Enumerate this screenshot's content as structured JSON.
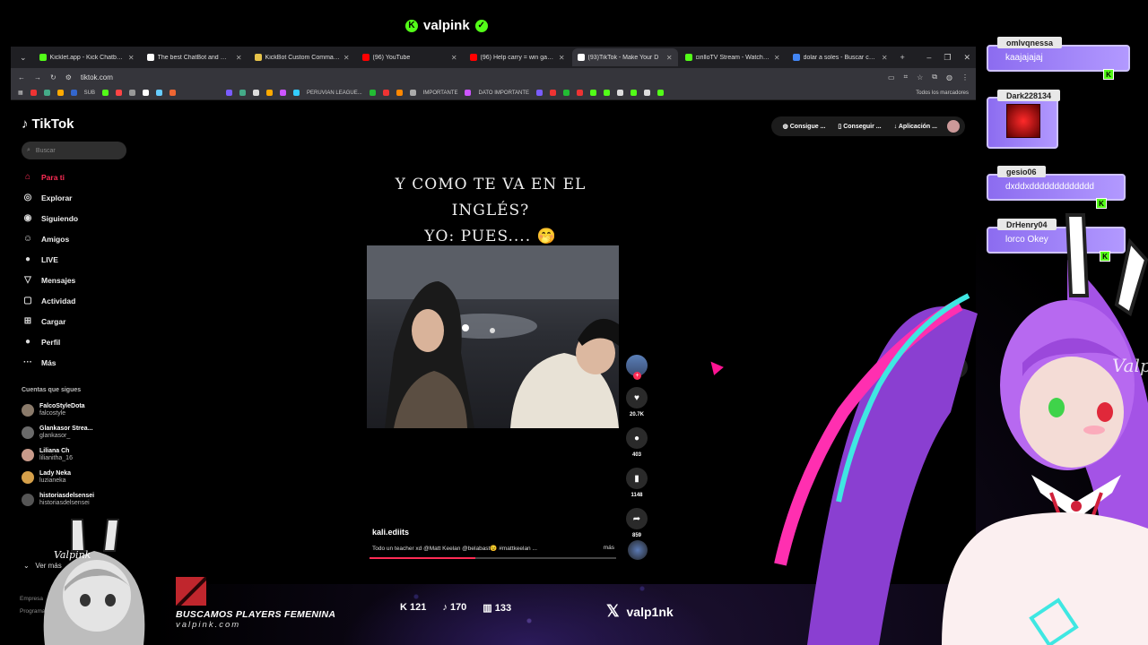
{
  "stream": {
    "top_username": "valpink",
    "promo_text": "BUSCAMOS PLAYERS FEMENINA",
    "promo_url": "valpink.com",
    "stat_followers": "121",
    "stat_likes": "170",
    "stat_viewers": "133",
    "x_handle": "valp1nk"
  },
  "browser": {
    "tabs": [
      {
        "label": "Kicklet.app - Kick Chatbot an",
        "color": "#53fc18"
      },
      {
        "label": "The best ChatBot and Widge",
        "color": "#ffffff"
      },
      {
        "label": "KickBot Custom Commands",
        "color": "#e6c34a"
      },
      {
        "label": "(96) YouTube",
        "color": "#ff0000"
      },
      {
        "label": "(96) Help carry = win game",
        "color": "#ff0000"
      },
      {
        "label": "(93)TikTok - Make Your D",
        "color": "#ffffff",
        "active": true
      },
      {
        "label": "cirilloTV Stream - Watch Live",
        "color": "#53fc18"
      },
      {
        "label": "dolar a soles - Buscar con Go",
        "color": "#4285f4"
      }
    ],
    "url": "tiktok.com",
    "bookmarks": [
      {
        "label": "SUB",
        "color": "#888"
      },
      {
        "label": "PERUVIAN LEAGUE...",
        "color": "#7a5cff"
      },
      {
        "label": "IMPORTANTE",
        "color": "#4285f4"
      },
      {
        "label": "DATO IMPORTANTE",
        "color": "#aaa"
      }
    ],
    "all_bookmarks": "Todos los marcadores"
  },
  "tiktok": {
    "logo": "TikTok",
    "search_placeholder": "Buscar",
    "nav": [
      {
        "label": "Para ti",
        "icon": "home-icon",
        "glyph": "⌂",
        "active": true
      },
      {
        "label": "Explorar",
        "icon": "compass-icon",
        "glyph": "◎"
      },
      {
        "label": "Siguiendo",
        "icon": "following-icon",
        "glyph": "◉"
      },
      {
        "label": "Amigos",
        "icon": "friends-icon",
        "glyph": "☺"
      },
      {
        "label": "LIVE",
        "icon": "live-icon",
        "glyph": "●"
      },
      {
        "label": "Mensajes",
        "icon": "messages-icon",
        "glyph": "▽"
      },
      {
        "label": "Actividad",
        "icon": "activity-icon",
        "glyph": "▢"
      },
      {
        "label": "Cargar",
        "icon": "upload-icon",
        "glyph": "⊞"
      },
      {
        "label": "Perfil",
        "icon": "profile-icon",
        "glyph": "●"
      },
      {
        "label": "Más",
        "icon": "more-icon",
        "glyph": "···"
      }
    ],
    "following_title": "Cuentas que sigues",
    "following": [
      {
        "name": "FalcoStyleDota",
        "handle": "falcostyle",
        "color": "#8a7a6a"
      },
      {
        "name": "Glankasor Strea...",
        "handle": "glankasor_",
        "color": "#6a6a6a"
      },
      {
        "name": "Liliana Ch",
        "handle": "lilianitha_16",
        "color": "#c89a8a"
      },
      {
        "name": "Lady Neka",
        "handle": "luzianeka",
        "color": "#d6a04a"
      },
      {
        "name": "historiasdelsensei",
        "handle": "historiasdelsensei",
        "color": "#555"
      }
    ],
    "ver_mas": "Ver más",
    "footer": [
      "Empresa",
      "Programa"
    ],
    "top_buttons": [
      "Consigue ...",
      "Conseguir ...",
      "Aplicación ..."
    ],
    "caption_line1": "Y COMO TE VA EN EL INGLÉS?",
    "caption_line2": "YO: PUES.... 🤭",
    "author": "kali.ediits",
    "description": "Todo un teacher xd @Matt Keelan @belabast😉 #mattkeelan ...",
    "more_label": "más",
    "progress": 0.43,
    "likes": "20.7K",
    "comments": "403",
    "saves": "1148",
    "shares": "859"
  },
  "chat": [
    {
      "user": "omlvqnessa",
      "message": "kaajajajaj"
    },
    {
      "user": "Dark228134",
      "message": ""
    },
    {
      "user": "gesio06",
      "message": "dxddxddddddddddddd"
    },
    {
      "user": "DrHenry04",
      "message": "lorco Okey"
    }
  ]
}
